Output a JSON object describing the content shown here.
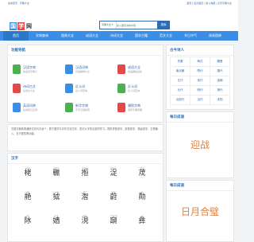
{
  "topbar": {
    "left": "在线查字 · 字典大全",
    "right": "首页 | 设为首页 | 加入收藏 | 汉字字典大全"
  },
  "logo": {
    "chars": [
      "国",
      "学",
      "网"
    ],
    "colors": [
      "#3a8ee6",
      "#e24a4a",
      "#3a8ee6"
    ]
  },
  "search": {
    "select": "字典大全 ▾",
    "placeholder": "输入要查询的内容",
    "button": "搜索"
  },
  "nav": [
    "首页",
    "学典查询",
    "国典大全",
    "成语大全",
    "诗词大全",
    "国学古籍",
    "范文大全",
    "节日节气",
    "周易国典",
    "更多"
  ],
  "functions": {
    "title": "功能导航",
    "items": [
      {
        "name": "汉语字典",
        "desc": "快速查字释义",
        "icon": "dict-icon",
        "color": "#4caf50"
      },
      {
        "name": "汉语词典",
        "desc": "词语解释大全",
        "icon": "book-icon",
        "color": "#3a8ee6"
      },
      {
        "name": "成语大全",
        "desc": "成语典故出处",
        "icon": "idiom-icon",
        "color": "#e24a4a"
      },
      {
        "name": "诗词古文",
        "desc": "古诗文大全",
        "icon": "poem-icon",
        "color": "#e24a4a"
      },
      {
        "name": "近义词",
        "desc": "近义词查询",
        "icon": "synonym-icon",
        "color": "#3a8ee6"
      },
      {
        "name": "反义词",
        "desc": "反义词查询",
        "icon": "antonym-icon",
        "color": "#4caf50"
      },
      {
        "name": "英语词典",
        "desc": "在线英汉互译",
        "icon": "english-icon",
        "color": "#3a8ee6"
      },
      {
        "name": "新华字典",
        "desc": "字字汉语拼音",
        "icon": "xinhua-icon",
        "color": "#4caf50"
      },
      {
        "name": "康熙字典",
        "desc": "康熙字典原图",
        "icon": "kangxi-icon",
        "color": "#e24a4a"
      }
    ]
  },
  "intro": "汉语字典收录通用汉字约万余个，属于国学与中华文化汉字，查字从字形出发的学习，提供拼音查字、部首查字、笔画查字、五笔输入、五行属性等功能。",
  "hanzi": {
    "title": "汉字",
    "items": [
      {
        "py": "kǎo",
        "ch": "栳"
      },
      {
        "py": "chān",
        "ch": "辴"
      },
      {
        "py": "yǒng",
        "ch": "搄"
      },
      {
        "py": "zhuó",
        "ch": "浞"
      },
      {
        "py": "shù",
        "ch": "荗"
      },
      {
        "py": "chì",
        "ch": "艵"
      },
      {
        "py": "yuè",
        "ch": "狘"
      },
      {
        "py": "zhì",
        "ch": "潪"
      },
      {
        "py": "wèi",
        "ch": "蔚"
      },
      {
        "py": "jī",
        "ch": "勣"
      },
      {
        "py": "yīn",
        "ch": "阥"
      },
      {
        "py": "huì",
        "ch": "嫱"
      },
      {
        "py": "xiǎn",
        "ch": "涀"
      },
      {
        "py": "chēng",
        "ch": "竀"
      },
      {
        "py": "yí",
        "ch": "彝"
      }
    ]
  },
  "poets": {
    "title": "古今诗人",
    "grid": [
      [
        "先秦",
        "两汉",
        "魏晋"
      ],
      [
        "南北朝",
        "隋代",
        "唐代"
      ],
      [
        "五代",
        "宋代",
        "金朝"
      ],
      [
        "元代",
        "明代",
        "清代"
      ],
      [
        "近现代",
        "当代",
        "未知"
      ]
    ]
  },
  "idiom1": {
    "title": "每日成语",
    "text": "迎战"
  },
  "idiom2": {
    "title": "每日成语",
    "text": "日月合璧"
  }
}
